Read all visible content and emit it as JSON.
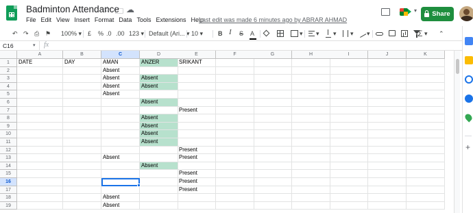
{
  "title_bar": {
    "doc_title": "Badminton Attendance",
    "star_icon": "star-icon",
    "move_icon": "folder-icon",
    "cloud_icon": "cloud-saved-icon",
    "menu": [
      "File",
      "Edit",
      "View",
      "Insert",
      "Format",
      "Data",
      "Tools",
      "Extensions",
      "Help"
    ],
    "last_edit": "Last edit was made 6 minutes ago by ABRAR AHMAD",
    "share_label": "Share",
    "share_color": "#1e8e3e"
  },
  "toolbar": {
    "zoom": "100%",
    "currency": "£",
    "percent": "%",
    "decimal_decrease": ".0",
    "decimal_increase": ".00",
    "more_formats": "123",
    "font": "Default (Ari...",
    "font_size": "10",
    "bold": "B",
    "italic": "I",
    "strikethrough": "S",
    "text_color": "A"
  },
  "formula_bar": {
    "name_box": "C16",
    "fx": "fx",
    "value": ""
  },
  "grid": {
    "columns": [
      "A",
      "B",
      "C",
      "D",
      "E",
      "F",
      "G",
      "H",
      "I",
      "J",
      "K"
    ],
    "selected_column": "C",
    "selected_row": 16,
    "active_cell": "C16",
    "green_fill": "#b7e1cd",
    "rows": [
      {
        "num": "1",
        "cells": [
          "DATE",
          "DAY",
          "AMAN",
          "ANZER",
          "SRIKANT",
          "",
          "",
          "",
          "",
          "",
          ""
        ]
      },
      {
        "num": "2",
        "cells": [
          "",
          "",
          "Absent",
          "",
          "",
          "",
          "",
          "",
          "",
          "",
          ""
        ]
      },
      {
        "num": "3",
        "cells": [
          "",
          "",
          "Absent",
          "Absent",
          "",
          "",
          "",
          "",
          "",
          "",
          ""
        ]
      },
      {
        "num": "4",
        "cells": [
          "",
          "",
          "Absent",
          "Absent",
          "",
          "",
          "",
          "",
          "",
          "",
          ""
        ]
      },
      {
        "num": "5",
        "cells": [
          "",
          "",
          "Absent",
          "",
          "",
          "",
          "",
          "",
          "",
          "",
          ""
        ]
      },
      {
        "num": "6",
        "cells": [
          "",
          "",
          "",
          "Absent",
          "",
          "",
          "",
          "",
          "",
          "",
          ""
        ]
      },
      {
        "num": "7",
        "cells": [
          "",
          "",
          "",
          "",
          "Present",
          "",
          "",
          "",
          "",
          "",
          ""
        ]
      },
      {
        "num": "8",
        "cells": [
          "",
          "",
          "",
          "Absent",
          "",
          "",
          "",
          "",
          "",
          "",
          ""
        ]
      },
      {
        "num": "9",
        "cells": [
          "",
          "",
          "",
          "Absent",
          "",
          "",
          "",
          "",
          "",
          "",
          ""
        ]
      },
      {
        "num": "10",
        "cells": [
          "",
          "",
          "",
          "Absent",
          "",
          "",
          "",
          "",
          "",
          "",
          ""
        ]
      },
      {
        "num": "11",
        "cells": [
          "",
          "",
          "",
          "Absent",
          "",
          "",
          "",
          "",
          "",
          "",
          ""
        ]
      },
      {
        "num": "12",
        "cells": [
          "",
          "",
          "",
          "",
          "Present",
          "",
          "",
          "",
          "",
          "",
          ""
        ]
      },
      {
        "num": "13",
        "cells": [
          "",
          "",
          "Absent",
          "",
          "Present",
          "",
          "",
          "",
          "",
          "",
          ""
        ]
      },
      {
        "num": "14",
        "cells": [
          "",
          "",
          "",
          "Absent",
          "",
          "",
          "",
          "",
          "",
          "",
          ""
        ]
      },
      {
        "num": "15",
        "cells": [
          "",
          "",
          "",
          "",
          "Present",
          "",
          "",
          "",
          "",
          "",
          ""
        ]
      },
      {
        "num": "16",
        "cells": [
          "",
          "",
          "",
          "",
          "Present",
          "",
          "",
          "",
          "",
          "",
          ""
        ]
      },
      {
        "num": "17",
        "cells": [
          "",
          "",
          "",
          "",
          "Present",
          "",
          "",
          "",
          "",
          "",
          ""
        ]
      },
      {
        "num": "18",
        "cells": [
          "",
          "",
          "Absent",
          "",
          "",
          "",
          "",
          "",
          "",
          "",
          ""
        ]
      },
      {
        "num": "19",
        "cells": [
          "",
          "",
          "Absent",
          "",
          "",
          "",
          "",
          "",
          "",
          "",
          ""
        ]
      }
    ],
    "green_cells": [
      "D1",
      "D3",
      "D4",
      "D6",
      "D8",
      "D9",
      "D10",
      "D11",
      "D14"
    ]
  },
  "side_panel": {
    "items": [
      "calendar-icon",
      "keep-icon",
      "tasks-icon",
      "contacts-icon",
      "maps-icon",
      "add-icon"
    ]
  }
}
